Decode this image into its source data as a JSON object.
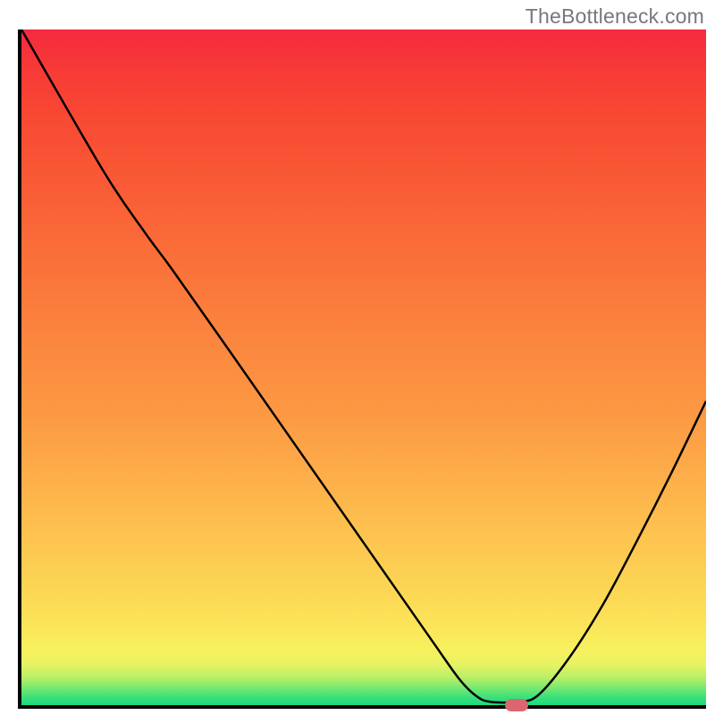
{
  "watermark": "TheBottleneck.com",
  "chart_data": {
    "type": "line",
    "title": "",
    "xlabel": "",
    "ylabel": "",
    "x_range": [
      0,
      100
    ],
    "y_range": [
      0,
      100
    ],
    "series": [
      {
        "name": "curve",
        "points": [
          {
            "x": 0.0,
            "y": 100.0
          },
          {
            "x": 12.0,
            "y": 79.0
          },
          {
            "x": 18.0,
            "y": 70.0
          },
          {
            "x": 22.0,
            "y": 64.5
          },
          {
            "x": 30.0,
            "y": 53.0
          },
          {
            "x": 40.0,
            "y": 38.5
          },
          {
            "x": 50.0,
            "y": 24.0
          },
          {
            "x": 60.0,
            "y": 9.5
          },
          {
            "x": 64.0,
            "y": 3.8
          },
          {
            "x": 66.5,
            "y": 1.3
          },
          {
            "x": 68.5,
            "y": 0.5
          },
          {
            "x": 72.5,
            "y": 0.5
          },
          {
            "x": 75.5,
            "y": 1.5
          },
          {
            "x": 80.0,
            "y": 7.0
          },
          {
            "x": 85.0,
            "y": 15.0
          },
          {
            "x": 90.0,
            "y": 24.5
          },
          {
            "x": 95.0,
            "y": 34.5
          },
          {
            "x": 100.0,
            "y": 45.0
          }
        ]
      }
    ],
    "marker": {
      "x": 72.0,
      "y": 0.5
    },
    "colors": {
      "curve": "#000000",
      "marker": "#dc6670",
      "gradient_top": "#f52c40",
      "gradient_bottom": "#1ada7f"
    }
  }
}
